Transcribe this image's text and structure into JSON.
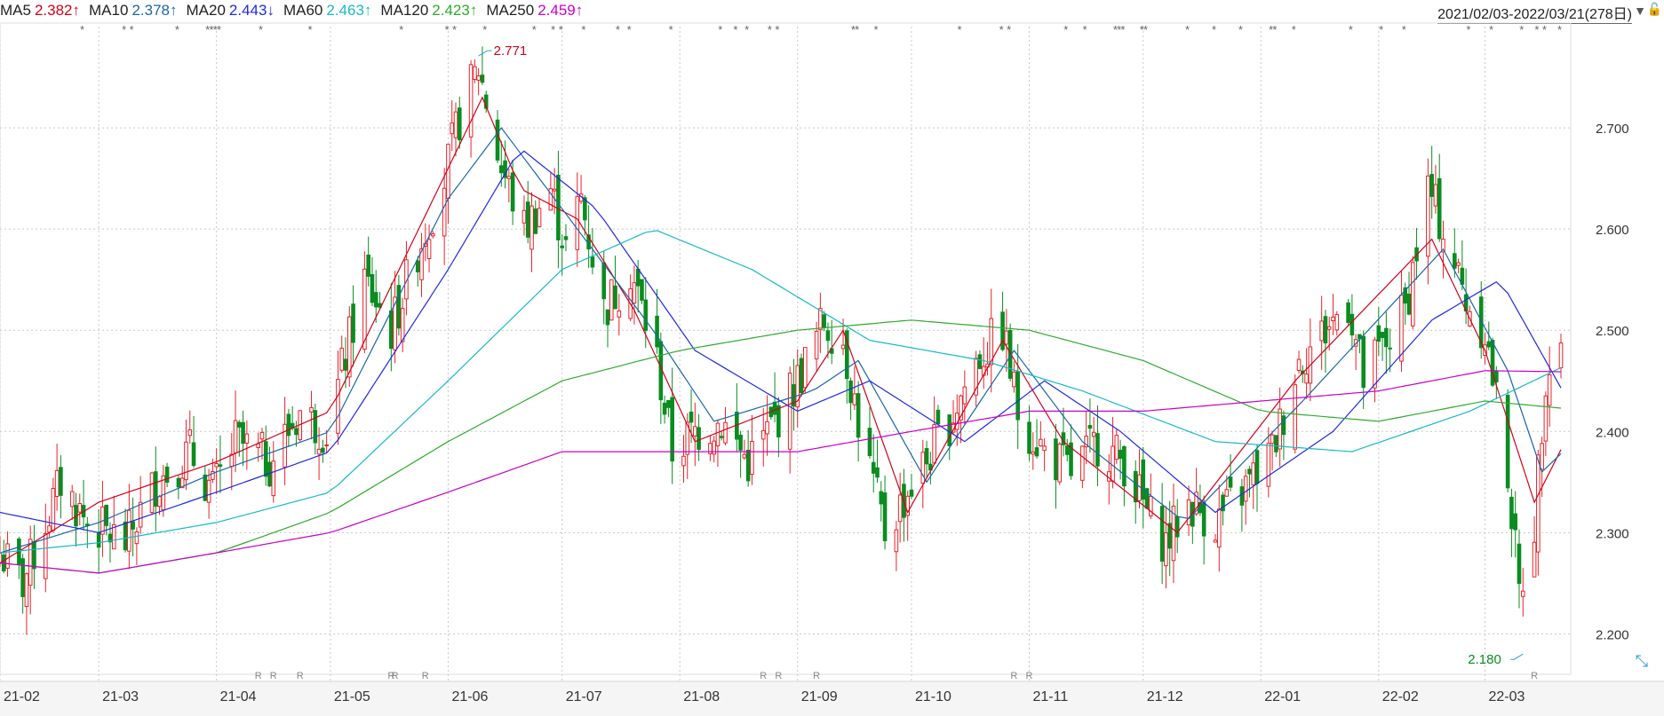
{
  "header": {
    "ma": [
      {
        "name": "MA5",
        "value": "2.382",
        "arrow": "↑",
        "color": "#d0021b"
      },
      {
        "name": "MA10",
        "value": "2.378",
        "arrow": "↑",
        "color": "#1a66a8"
      },
      {
        "name": "MA20",
        "value": "2.443",
        "arrow": "↓",
        "color": "#1f2ae0"
      },
      {
        "name": "MA60",
        "value": "2.463",
        "arrow": "↑",
        "color": "#19b8c8"
      },
      {
        "name": "MA120",
        "value": "2.423",
        "arrow": "↑",
        "color": "#2eaa2e"
      },
      {
        "name": "MA250",
        "value": "2.459",
        "arrow": "↑",
        "color": "#c800c8"
      }
    ],
    "date_range": "2021/02/03-2022/03/21(278日)",
    "dropdown_icon": "triangle-down-icon",
    "lock_icon": "lock-icon",
    "expand_icon": "expand-arrows-icon"
  },
  "chart_data": {
    "type": "candlestick",
    "x_ticks": [
      "21-02",
      "21-03",
      "21-04",
      "21-05",
      "21-06",
      "21-07",
      "21-08",
      "21-09",
      "21-10",
      "21-11",
      "21-12",
      "22-01",
      "22-02",
      "22-03"
    ],
    "ylim": [
      2.16,
      2.8
    ],
    "y_ticks": [
      "2.700",
      "2.600",
      "2.500",
      "2.400",
      "2.300",
      "2.200"
    ],
    "grid": true,
    "colors": {
      "up": "#e8222a",
      "down": "#0a8c20"
    },
    "high_label": "2.771",
    "low_label": "2.180",
    "star_marker": "*",
    "r_marker": "R",
    "series": [
      {
        "name": "MA5",
        "color": "#d0021b"
      },
      {
        "name": "MA10",
        "color": "#1a66a8"
      },
      {
        "name": "MA20",
        "color": "#1f2ae0"
      },
      {
        "name": "MA60",
        "color": "#19b8c8"
      },
      {
        "name": "MA120",
        "color": "#2eaa2e"
      },
      {
        "name": "MA250",
        "color": "#c800c8"
      }
    ],
    "anchors": [
      {
        "d": "2021-02-03",
        "c": 2.28
      },
      {
        "d": "2021-02-09",
        "c": 2.25
      },
      {
        "d": "2021-02-19",
        "c": 2.35
      },
      {
        "d": "2021-02-26",
        "c": 2.31
      },
      {
        "d": "2021-03-08",
        "c": 2.29
      },
      {
        "d": "2021-03-16",
        "c": 2.35
      },
      {
        "d": "2021-03-25",
        "c": 2.38
      },
      {
        "d": "2021-03-31",
        "c": 2.34
      },
      {
        "d": "2021-04-06",
        "c": 2.39
      },
      {
        "d": "2021-04-15",
        "c": 2.37
      },
      {
        "d": "2021-04-23",
        "c": 2.42
      },
      {
        "d": "2021-04-30",
        "c": 2.4
      },
      {
        "d": "2021-05-10",
        "c": 2.55
      },
      {
        "d": "2021-05-17",
        "c": 2.5
      },
      {
        "d": "2021-05-24",
        "c": 2.58
      },
      {
        "d": "2021-05-31",
        "c": 2.65
      },
      {
        "d": "2021-06-04",
        "c": 2.71
      },
      {
        "d": "2021-06-09",
        "c": 2.76
      },
      {
        "d": "2021-06-15",
        "c": 2.66
      },
      {
        "d": "2021-06-21",
        "c": 2.6
      },
      {
        "d": "2021-06-28",
        "c": 2.64
      },
      {
        "d": "2021-07-02",
        "c": 2.58
      },
      {
        "d": "2021-07-06",
        "c": 2.63
      },
      {
        "d": "2021-07-12",
        "c": 2.52
      },
      {
        "d": "2021-07-19",
        "c": 2.56
      },
      {
        "d": "2021-07-26",
        "c": 2.47
      },
      {
        "d": "2021-07-30",
        "c": 2.38
      },
      {
        "d": "2021-08-05",
        "c": 2.4
      },
      {
        "d": "2021-08-12",
        "c": 2.41
      },
      {
        "d": "2021-08-19",
        "c": 2.37
      },
      {
        "d": "2021-08-26",
        "c": 2.41
      },
      {
        "d": "2021-09-01",
        "c": 2.45
      },
      {
        "d": "2021-09-08",
        "c": 2.51
      },
      {
        "d": "2021-09-13",
        "c": 2.49
      },
      {
        "d": "2021-09-17",
        "c": 2.41
      },
      {
        "d": "2021-09-24",
        "c": 2.3
      },
      {
        "d": "2021-09-30",
        "c": 2.34
      },
      {
        "d": "2021-10-11",
        "c": 2.41
      },
      {
        "d": "2021-10-18",
        "c": 2.47
      },
      {
        "d": "2021-10-25",
        "c": 2.5
      },
      {
        "d": "2021-10-29",
        "c": 2.42
      },
      {
        "d": "2021-11-05",
        "c": 2.38
      },
      {
        "d": "2021-11-12",
        "c": 2.36
      },
      {
        "d": "2021-11-19",
        "c": 2.39
      },
      {
        "d": "2021-11-26",
        "c": 2.37
      },
      {
        "d": "2021-12-02",
        "c": 2.32
      },
      {
        "d": "2021-12-07",
        "c": 2.29
      },
      {
        "d": "2021-12-13",
        "c": 2.33
      },
      {
        "d": "2021-12-20",
        "c": 2.31
      },
      {
        "d": "2021-12-27",
        "c": 2.34
      },
      {
        "d": "2022-01-04",
        "c": 2.38
      },
      {
        "d": "2022-01-11",
        "c": 2.47
      },
      {
        "d": "2022-01-18",
        "c": 2.5
      },
      {
        "d": "2022-01-24",
        "c": 2.53
      },
      {
        "d": "2022-01-28",
        "c": 2.45
      },
      {
        "d": "2022-02-08",
        "c": 2.52
      },
      {
        "d": "2022-02-14",
        "c": 2.64
      },
      {
        "d": "2022-02-18",
        "c": 2.6
      },
      {
        "d": "2022-02-24",
        "c": 2.53
      },
      {
        "d": "2022-03-01",
        "c": 2.5
      },
      {
        "d": "2022-03-07",
        "c": 2.36
      },
      {
        "d": "2022-03-10",
        "c": 2.24
      },
      {
        "d": "2022-03-14",
        "c": 2.31
      },
      {
        "d": "2022-03-17",
        "c": 2.46
      },
      {
        "d": "2022-03-21",
        "c": 2.49
      }
    ],
    "ma_anchors": {
      "MA5": [
        [
          "2021-02-03",
          2.27
        ],
        [
          "2021-03-01",
          2.33
        ],
        [
          "2021-04-01",
          2.37
        ],
        [
          "2021-05-01",
          2.42
        ],
        [
          "2021-06-01",
          2.66
        ],
        [
          "2021-06-10",
          2.73
        ],
        [
          "2021-06-20",
          2.64
        ],
        [
          "2021-07-05",
          2.61
        ],
        [
          "2021-07-20",
          2.52
        ],
        [
          "2021-08-05",
          2.39
        ],
        [
          "2021-09-01",
          2.43
        ],
        [
          "2021-09-13",
          2.5
        ],
        [
          "2021-09-30",
          2.32
        ],
        [
          "2021-10-25",
          2.49
        ],
        [
          "2021-11-10",
          2.39
        ],
        [
          "2021-12-10",
          2.3
        ],
        [
          "2022-01-10",
          2.45
        ],
        [
          "2022-02-15",
          2.59
        ],
        [
          "2022-03-01",
          2.48
        ],
        [
          "2022-03-14",
          2.33
        ],
        [
          "2022-03-21",
          2.382
        ]
      ],
      "MA10": [
        [
          "2021-02-03",
          2.28
        ],
        [
          "2021-03-01",
          2.31
        ],
        [
          "2021-04-01",
          2.36
        ],
        [
          "2021-05-01",
          2.4
        ],
        [
          "2021-06-01",
          2.63
        ],
        [
          "2021-06-15",
          2.7
        ],
        [
          "2021-07-05",
          2.6
        ],
        [
          "2021-07-25",
          2.5
        ],
        [
          "2021-08-10",
          2.41
        ],
        [
          "2021-09-05",
          2.44
        ],
        [
          "2021-09-17",
          2.47
        ],
        [
          "2021-10-05",
          2.35
        ],
        [
          "2021-10-28",
          2.48
        ],
        [
          "2021-11-15",
          2.39
        ],
        [
          "2021-12-12",
          2.31
        ],
        [
          "2022-01-12",
          2.43
        ],
        [
          "2022-02-18",
          2.58
        ],
        [
          "2022-03-07",
          2.46
        ],
        [
          "2022-03-16",
          2.36
        ],
        [
          "2022-03-21",
          2.378
        ]
      ],
      "MA20": [
        [
          "2021-02-03",
          2.32
        ],
        [
          "2021-03-01",
          2.3
        ],
        [
          "2021-04-01",
          2.34
        ],
        [
          "2021-05-01",
          2.38
        ],
        [
          "2021-06-01",
          2.56
        ],
        [
          "2021-06-20",
          2.68
        ],
        [
          "2021-07-10",
          2.62
        ],
        [
          "2021-08-05",
          2.48
        ],
        [
          "2021-09-01",
          2.42
        ],
        [
          "2021-09-20",
          2.45
        ],
        [
          "2021-10-15",
          2.39
        ],
        [
          "2021-11-05",
          2.45
        ],
        [
          "2021-11-25",
          2.4
        ],
        [
          "2021-12-20",
          2.32
        ],
        [
          "2022-01-20",
          2.4
        ],
        [
          "2022-02-15",
          2.51
        ],
        [
          "2022-03-05",
          2.55
        ],
        [
          "2022-03-21",
          2.443
        ]
      ],
      "MA60": [
        [
          "2021-02-03",
          2.28
        ],
        [
          "2021-03-01",
          2.29
        ],
        [
          "2021-04-01",
          2.31
        ],
        [
          "2021-05-01",
          2.34
        ],
        [
          "2021-06-01",
          2.45
        ],
        [
          "2021-07-01",
          2.56
        ],
        [
          "2021-07-25",
          2.6
        ],
        [
          "2021-08-20",
          2.56
        ],
        [
          "2021-09-20",
          2.49
        ],
        [
          "2021-10-20",
          2.47
        ],
        [
          "2021-11-15",
          2.44
        ],
        [
          "2021-12-20",
          2.39
        ],
        [
          "2022-01-25",
          2.38
        ],
        [
          "2022-02-25",
          2.42
        ],
        [
          "2022-03-21",
          2.463
        ]
      ],
      "MA120": [
        [
          "2021-02-03",
          2.27
        ],
        [
          "2021-03-01",
          2.26
        ],
        [
          "2021-04-01",
          2.28
        ],
        [
          "2021-05-01",
          2.32
        ],
        [
          "2021-06-01",
          2.39
        ],
        [
          "2021-07-01",
          2.45
        ],
        [
          "2021-08-01",
          2.48
        ],
        [
          "2021-09-01",
          2.5
        ],
        [
          "2021-10-01",
          2.51
        ],
        [
          "2021-11-01",
          2.5
        ],
        [
          "2021-12-01",
          2.47
        ],
        [
          "2022-01-01",
          2.42
        ],
        [
          "2022-02-01",
          2.41
        ],
        [
          "2022-03-01",
          2.43
        ],
        [
          "2022-03-21",
          2.423
        ]
      ],
      "MA250": [
        [
          "2021-02-03",
          2.27
        ],
        [
          "2021-03-01",
          2.26
        ],
        [
          "2021-04-01",
          2.28
        ],
        [
          "2021-05-01",
          2.3
        ],
        [
          "2021-06-01",
          2.34
        ],
        [
          "2021-07-01",
          2.38
        ],
        [
          "2021-08-01",
          2.38
        ],
        [
          "2021-09-01",
          2.38
        ],
        [
          "2021-10-01",
          2.4
        ],
        [
          "2021-11-01",
          2.42
        ],
        [
          "2021-12-01",
          2.42
        ],
        [
          "2022-01-01",
          2.43
        ],
        [
          "2022-02-01",
          2.44
        ],
        [
          "2022-03-01",
          2.46
        ],
        [
          "2022-03-21",
          2.459
        ]
      ]
    },
    "high": {
      "d": "2021-06-09",
      "v": 2.771
    },
    "low": {
      "d": "2022-03-11",
      "v": 2.18
    }
  }
}
